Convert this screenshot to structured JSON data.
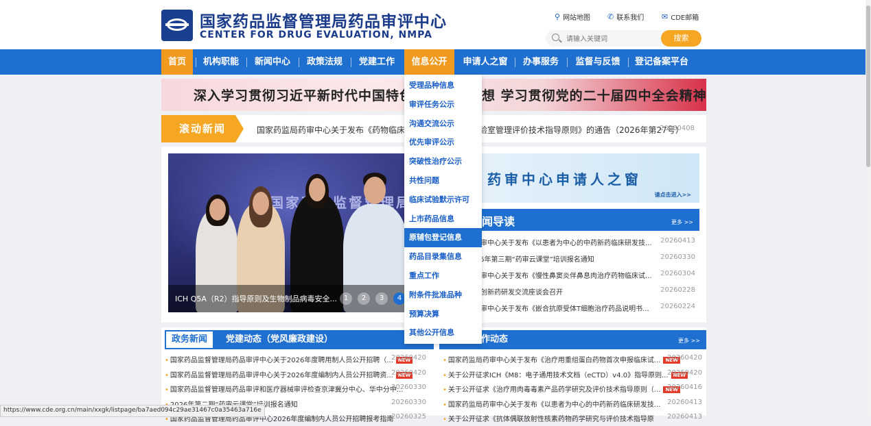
{
  "header": {
    "title_cn": "国家药品监督管理局药品审评中心",
    "title_en": "CENTER FOR DRUG EVALUATION, NMPA",
    "links": [
      {
        "label": "网站地图",
        "icon": "map-pin-icon"
      },
      {
        "label": "联系我们",
        "icon": "phone-icon"
      },
      {
        "label": "CDE邮箱",
        "icon": "mail-icon"
      }
    ],
    "search_placeholder": "请输入关键词",
    "search_button": "搜索"
  },
  "nav": {
    "items": [
      "首页",
      "机构职能",
      "新闻中心",
      "政策法规",
      "党建工作",
      "信息公开",
      "申请人之窗",
      "办事服务",
      "监督与反馈",
      "登记备案平台"
    ],
    "active_home": "首页",
    "active_open": "信息公开"
  },
  "dropdown": {
    "items": [
      "受理品种信息",
      "审评任务公示",
      "沟通交流公示",
      "优先审评公示",
      "突破性治疗公示",
      "共性问题",
      "临床试验默示许可",
      "上市药品信息",
      "原辅包登记信息",
      "药品目录集信息",
      "重点工作",
      "附条件批准品种",
      "预算决算",
      "其他公开信息"
    ],
    "hovered": "原辅包登记信息"
  },
  "banner": {
    "text": "深入学习贯彻习近平新时代中国特色社会主义思想 学习贯彻党的二十届四中全会精神"
  },
  "scroll_news": {
    "label": "滚动新闻",
    "text": "国家药监局药审中心关于发布《药物临床试验生物样本分析实验室管理评价技术指导原则》的通告（2026年第27号）",
    "date": "20260408"
  },
  "carousel": {
    "caption": "ICH Q5A（R2）指导原则及生物制品病毒安全...",
    "wall_text": "国家药品监督管理局",
    "dots": [
      "1",
      "2",
      "3",
      "4"
    ],
    "active_dot": "4"
  },
  "applicant_window": {
    "title": "药审中心申请人之窗",
    "sub": "请点击进入>>"
  },
  "guide": {
    "title": "要闻导读",
    "more": "更多 >>",
    "items": [
      {
        "text": "国家药监局药审中心关于发布《以患者为中心的中药新药临床研发技...",
        "date": "20260413"
      },
      {
        "text": "药审中心2026年第三期“药审云课堂”培训报名通知",
        "date": "20260330"
      },
      {
        "text": "国家药监局药审中心关于发布《慢性鼻窦炎伴鼻息肉治疗药物临床试...",
        "date": "20260304"
      },
      {
        "text": "药审中心召开创新药研发交流座谈会召开",
        "date": "20260228"
      },
      {
        "text": "国家药监局药审中心关于发布《嵌合抗原受体T细胞治疗药品说明书...",
        "date": "20260224"
      }
    ]
  },
  "bottom_left": {
    "tab_active": "政务新闻",
    "tab_other": "党建动态（党风廉政建设）",
    "items": [
      {
        "text": "国家药品监督管理局药品审评中心关于2026年度聘用制人员公开招聘（...",
        "new": "NEW",
        "date": "20260420"
      },
      {
        "text": "国家药品监督管理局药品审评中心关于2026年度编制内人员公开招聘资...",
        "new": "NEW",
        "date": "20260420"
      },
      {
        "text": "国家药品监督管理局药品审评和医疗器械审评检查京津冀分中心、华中分中...",
        "new": "",
        "date": "20260330"
      },
      {
        "text": "2026年第二期“药审云课堂”培训报名通知",
        "new": "",
        "date": "20260330"
      },
      {
        "text": "国家药品监督管理局药品审评中心2026年度编制内人员公开招聘报考指南",
        "new": "",
        "date": "20260325"
      }
    ]
  },
  "bottom_right": {
    "title": "工作动态",
    "more": "更多 >>",
    "items": [
      {
        "text": "国家药监局药审中心关于发布《治疗用重组蛋白药物首次申报临床试...",
        "new": "NEW",
        "date": "20260420"
      },
      {
        "text": "关于公开征求ICH《M8：电子通用技术文档（eCTD）v4.0》指导原则...",
        "new": "NEW",
        "date": "20260420"
      },
      {
        "text": "关于公开征求《治疗用肉毒毒素产品药学研究及评价技术指导原则（...",
        "new": "NEW",
        "date": "20260416"
      },
      {
        "text": "国家药监局药审中心关于发布《以患者为中心的中药新药临床研发技...",
        "new": "",
        "date": "20260413"
      },
      {
        "text": "关于公开征求《抗体偶联放射性核素药物药学研究与评价技术指导原",
        "new": "",
        "date": "20260413"
      }
    ]
  },
  "status_url": "https://www.cde.org.cn/main/xxgk/listpage/ba7aed094c29ae31467c0a35463a716e"
}
